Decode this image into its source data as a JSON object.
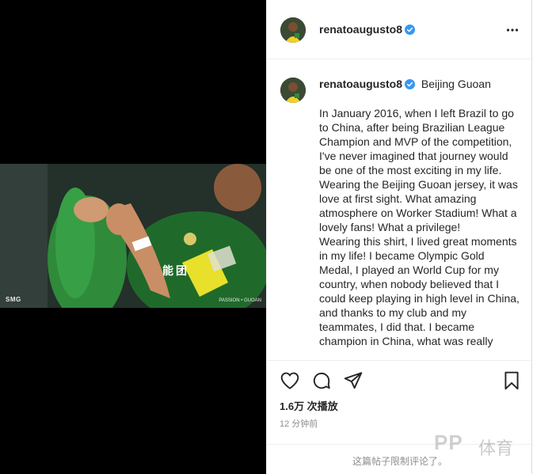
{
  "post": {
    "username": "renatoaugusto8",
    "location": "Beijing Guoan",
    "caption": "In January 2016, when I left Brazil to go to China, after being Brazilian League Champion and MVP of the competition, I've never imagined that journey would be one of the most exciting in my life.\nWearing the Beijing Guoan jersey, it was love at first sight. What amazing atmosphere on Worker Stadium! What a lovely fans! What a privilege!\nWearing this shirt, I lived great moments in my life! I became Olympic Gold Medal, I played an World Cup for my country, when nobody believed that I could keep playing in high level in China, and thanks to my club and my teammates, I did that. I became champion in China, what was really",
    "views": "1.6万 次播放",
    "timestamp": "12 分钟前",
    "comments_limited": "这篇帖子限制评论了。"
  },
  "media": {
    "watermark_left": "SMG",
    "watermark_right": "PASSION • GUOAN"
  },
  "watermark": {
    "brand": "PP",
    "brand_cn": "体育"
  },
  "icons": {
    "verified": "verified-badge-icon",
    "more": "more-options-icon",
    "like": "heart-icon",
    "comment": "comment-bubble-icon",
    "share": "paper-plane-icon",
    "save": "bookmark-icon"
  },
  "colors": {
    "verified_blue": "#3897f0",
    "jersey_green": "#2e7d32",
    "captain_band": "#e8e02a"
  }
}
